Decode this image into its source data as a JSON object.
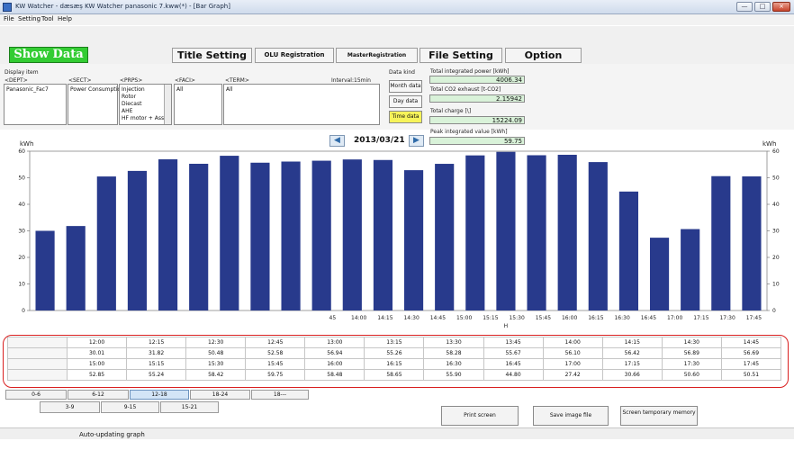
{
  "window": {
    "title": "KW Watcher - dæsæș KW Watcher panasonic 7.kww(*) - [Bar Graph]"
  },
  "menu": [
    "File",
    "Setting",
    "Tool",
    "Help"
  ],
  "toolbar": {
    "show_data": "Show Data",
    "buttons": [
      "Title Setting",
      "OLU Registration",
      "MasterRegistration",
      "File Setting",
      "Option"
    ]
  },
  "filters": {
    "display_item_label": "Display item",
    "dept_label": "<DEPT>",
    "sect_label": "<SECT>",
    "prps_label": "<PRPS>",
    "faci_label": "<FACI>",
    "term_label": "<TERM>",
    "interval_label": "Interval:15min",
    "dept_items": [
      "Panasonic_Fac7"
    ],
    "sect_items": [
      "Power Consumptio"
    ],
    "prps_items": [
      "Injection",
      "Rotor",
      "Diecast",
      "AHE",
      "HF motor + Ass"
    ],
    "faci_items": [
      "All"
    ],
    "term_items": [
      "All"
    ]
  },
  "data_kind": {
    "label": "Data kind",
    "options": [
      "Month data",
      "Day data",
      "Time data"
    ],
    "active": "Time data"
  },
  "summary": {
    "total_power_label": "Total integrated power [kWh]",
    "total_power": "4006.34",
    "total_co2_label": "Total CO2 exhaust [t-CO2]",
    "total_co2": "2.15942",
    "total_charge_label": "Total charge [\\]",
    "total_charge": "15224.09",
    "peak_label": "Peak integrated value [kWh]",
    "peak": "59.75"
  },
  "nav": {
    "date": "2013/03/21",
    "prev_icon": "arrow-left-icon",
    "next_icon": "arrow-right-icon"
  },
  "chart_data": {
    "type": "bar",
    "y_unit_left": "kWh",
    "y_unit_right": "kWh",
    "ylim": [
      0,
      60
    ],
    "yticks": [
      0,
      10,
      20,
      30,
      40,
      50,
      60
    ],
    "categories": [
      "12:00",
      "12:15",
      "12:30",
      "12:45",
      "13:00",
      "13:15",
      "13:30",
      "13:45",
      "14:00",
      "14:15",
      "14:30",
      "14:45",
      "15:00",
      "15:15",
      "15:30",
      "15:45",
      "16:00",
      "16:15",
      "16:30",
      "16:45",
      "17:00",
      "17:15",
      "17:30",
      "17:45"
    ],
    "visible_tick_labels": [
      "",
      "",
      "",
      "",
      "",
      "",
      "",
      "",
      "",
      "",
      "",
      "45",
      "14:00",
      "14:15",
      "14:30",
      "14:45",
      "15:00",
      "15:15",
      "15:30",
      "15:45",
      "16:00",
      "16:15",
      "16:30",
      "16:45",
      "17:00",
      "17:15",
      "17:30",
      "17:45"
    ],
    "values": [
      30.01,
      31.82,
      50.48,
      52.58,
      56.94,
      55.26,
      58.28,
      55.67,
      56.1,
      56.42,
      56.89,
      56.69,
      52.85,
      55.24,
      58.42,
      59.75,
      58.48,
      58.65,
      55.9,
      44.8,
      27.42,
      30.66,
      50.6,
      50.51
    ],
    "bar_color": "#283a8c",
    "grid": false,
    "hour_marker": "H"
  },
  "table": {
    "rows": [
      [
        "12:00",
        "12:15",
        "12:30",
        "12:45",
        "13:00",
        "13:15",
        "13:30",
        "13:45",
        "14:00",
        "14:15",
        "14:30",
        "14:45"
      ],
      [
        "30.01",
        "31.82",
        "50.48",
        "52.58",
        "56.94",
        "55.26",
        "58.28",
        "55.67",
        "56.10",
        "56.42",
        "56.89",
        "56.69"
      ],
      [
        "15:00",
        "15:15",
        "15:30",
        "15:45",
        "16:00",
        "16:15",
        "16:30",
        "16:45",
        "17:00",
        "17:15",
        "17:30",
        "17:45"
      ],
      [
        "52.85",
        "55.24",
        "58.42",
        "59.75",
        "58.48",
        "58.65",
        "55.90",
        "44.80",
        "27.42",
        "30.66",
        "50.60",
        "50.51"
      ]
    ]
  },
  "paging": {
    "range_buttons": [
      "0-6",
      "6-12",
      "12-18",
      "18-24",
      "18---"
    ],
    "range_selected": 2,
    "hour_buttons": [
      "3-9",
      "9-15",
      "15-21"
    ]
  },
  "actions": {
    "print": "Print screen",
    "save": "Save image file",
    "memory": "Screen temporary memory"
  },
  "status": {
    "text": "Auto-updating graph"
  }
}
